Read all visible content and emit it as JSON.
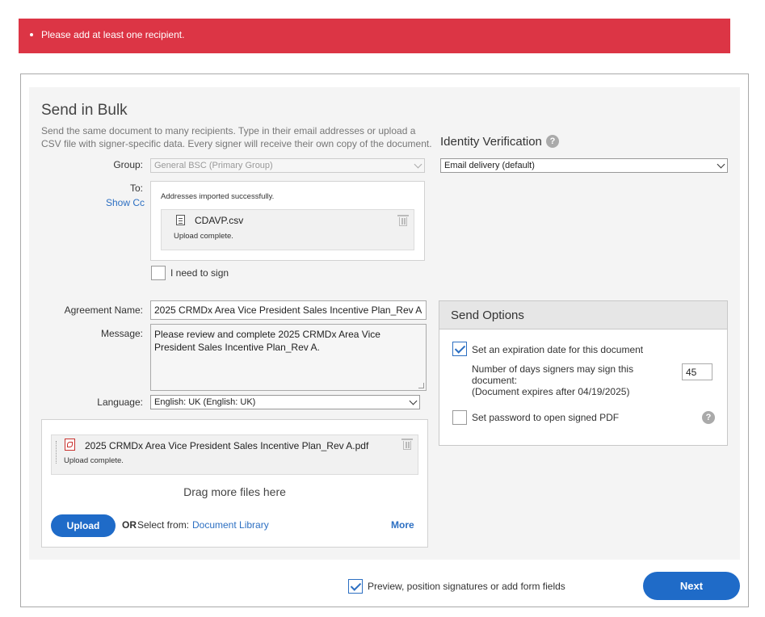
{
  "alert": {
    "message": "Please add at least one recipient."
  },
  "bulk": {
    "title": "Send in Bulk",
    "description": "Send the same document to many recipients. Type in their email addresses or upload a CSV file with signer-specific data. Every signer will receive their own copy of the document.",
    "group_label": "Group:",
    "group_value": "General BSC (Primary Group)",
    "to_label": "To:",
    "show_cc": "Show Cc",
    "import_status": "Addresses imported successfully.",
    "csv_file": {
      "name": "CDAVP.csv",
      "status": "Upload complete."
    },
    "i_need_to_sign": "I need to sign"
  },
  "identity": {
    "title": "Identity Verification",
    "help": "?",
    "select_value": "Email delivery (default)"
  },
  "agreement": {
    "name_label": "Agreement Name:",
    "name_value": "2025 CRMDx Area Vice President Sales Incentive Plan_Rev A",
    "message_label": "Message:",
    "message_value": "Please review and complete 2025 CRMDx Area Vice President Sales Incentive Plan_Rev A.",
    "language_label": "Language:",
    "language_value": "English: UK (English: UK)"
  },
  "files": {
    "document": {
      "name": "2025 CRMDx Area Vice President Sales Incentive Plan_Rev A.pdf",
      "status": "Upload complete."
    },
    "drag_text": "Drag more files here",
    "upload_button": "Upload",
    "or_label": "OR",
    "select_from": "Select from:",
    "library_link": "Document Library",
    "more_link": "More"
  },
  "send_options": {
    "title": "Send Options",
    "expiration_label": "Set an expiration date for this document",
    "expiration_checked": true,
    "days_label_1": "Number of days signers may sign this",
    "days_label_2": "document:",
    "days_expires": "(Document expires after 04/19/2025)",
    "days_value": "45",
    "password_label": "Set password to open signed PDF",
    "password_checked": false,
    "help": "?"
  },
  "footer": {
    "preview_label": "Preview, position signatures or add form fields",
    "preview_checked": true,
    "next_button": "Next"
  },
  "colors": {
    "alert": "#dc3545",
    "accent": "#1f6bc8",
    "link": "#2c6fc2",
    "panel": "#f4f4f4"
  }
}
